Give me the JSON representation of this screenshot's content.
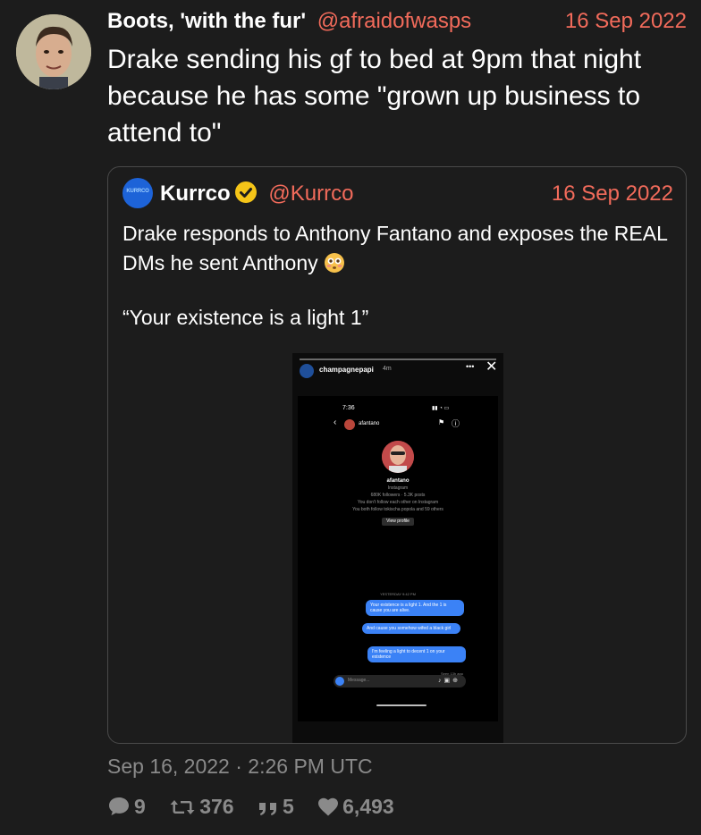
{
  "tweet": {
    "author_name": "Boots, 'with the fur'",
    "author_handle": "@afraidofwasps",
    "date": "16 Sep 2022",
    "text": "Drake sending his gf to bed at 9pm that night because he has some \"grown up business to attend to\"",
    "timestamp": "Sep 16, 2022 · 2:26 PM UTC"
  },
  "quote": {
    "avatar_text": "KURRCO",
    "author_name": "Kurrco",
    "author_handle": "@Kurrco",
    "date": "16 Sep 2022",
    "text_line1": "Drake responds to Anthony Fantano and exposes the REAL DMs he sent Anthony",
    "text_line2": "“Your existence is a light 1”",
    "story": {
      "username": "champagnepapi",
      "time_ago": "4m",
      "screen": {
        "clock": "7:36",
        "dm_user": "afantano",
        "profile_name": "afantano",
        "profile_sub": "Instagram",
        "followers_line": "680K followers · 5.3K posts",
        "follow_line": "You don't follow each other on Instagram",
        "mutual_line": "You both follow tokischa popola and 59 others",
        "view_profile": "View profile",
        "yesterday": "YESTERDAY 9:42 PM",
        "messages": [
          "Your existence is a light 1. And the 1 is cause you are alive.",
          "And cause you somehow wifed a black girl",
          "I'm feeling a light to decent 1 on your existence"
        ],
        "seen": "Seen 13h ago",
        "message_placeholder": "Message..."
      }
    }
  },
  "stats": {
    "replies": "9",
    "retweets": "376",
    "quotes": "5",
    "likes": "6,493"
  },
  "colors": {
    "background": "#1c1c1c",
    "accent": "#f26b5b",
    "muted": "#8a8a8a",
    "verified": "#f5c518"
  },
  "icons": {
    "reply": "comment-icon",
    "retweet": "retweet-icon",
    "quote": "quote-icon",
    "like": "heart-icon",
    "verified": "verified-badge-icon",
    "emoji": "flushed-face-emoji"
  }
}
